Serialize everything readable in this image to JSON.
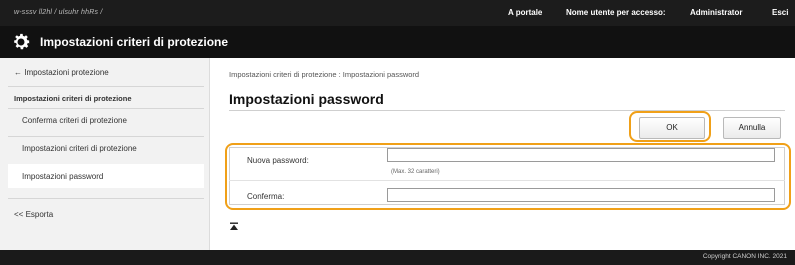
{
  "topbar": {
    "crumb": "w-sssv ll2hl / ulsuhr hhRs /",
    "portal": "A portale",
    "user_label": "Nome utente per accesso:",
    "user_name": "Administrator",
    "logout": "Esci"
  },
  "titlebar": {
    "icon": "gear-icon",
    "title": "Impostazioni criteri di protezione"
  },
  "sidebar": {
    "back": "← Impostazioni protezione",
    "section": "Impostazioni criteri di protezione",
    "items": [
      {
        "label": "Conferma criteri di protezione"
      },
      {
        "label": "Impostazioni criteri di protezione"
      },
      {
        "label": "Impostazioni password"
      }
    ],
    "export": "<< Esporta"
  },
  "main": {
    "breadcrumb": "Impostazioni criteri di protezione : Impostazioni password",
    "title": "Impostazioni password",
    "ok_label": "OK",
    "cancel_label": "Annulla",
    "fields": {
      "new_password": {
        "label": "Nuova password:",
        "value": "",
        "hint": "(Max. 32 caratteri)"
      },
      "confirm": {
        "label": "Conferma:",
        "value": ""
      }
    },
    "top_icon": "scroll-to-top-icon"
  },
  "footer": {
    "copyright": "Copyright CANON INC. 2021"
  },
  "colors": {
    "highlight": "#f0a018",
    "header_bg": "#111111",
    "sidebar_bg": "#f2f2f2"
  }
}
